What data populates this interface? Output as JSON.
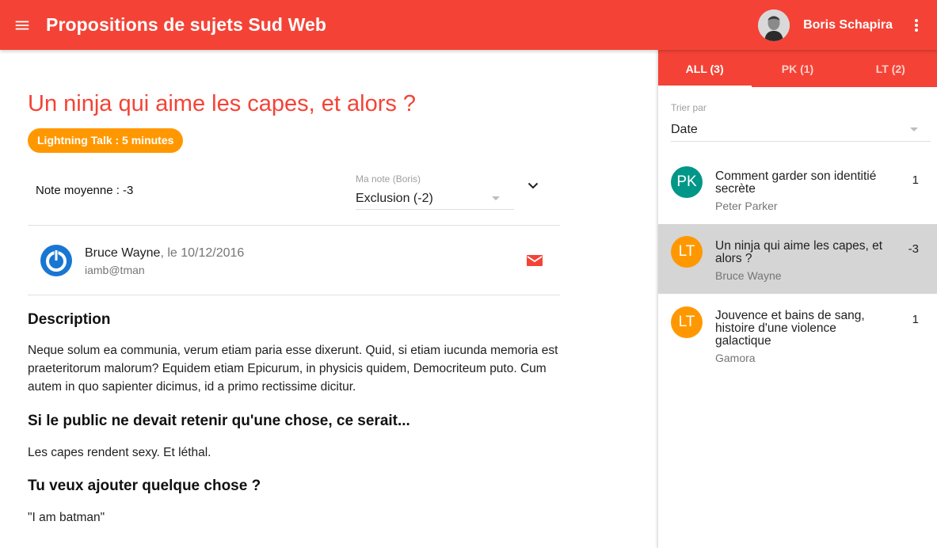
{
  "app": {
    "title": "Propositions de sujets Sud Web"
  },
  "user": {
    "name": "Boris Schapira"
  },
  "talk": {
    "title": "Un ninja qui aime les capes, et alors ?",
    "format_chip": "Lightning Talk : 5 minutes",
    "average_label": "Note moyenne : -3",
    "my_note_label": "Ma note (Boris)",
    "my_note_value": "Exclusion (-2)",
    "author_name": "Bruce Wayne",
    "author_date": ", le 10/12/2016",
    "author_email": "iamb@tman",
    "description_heading": "Description",
    "description_text": "Neque solum ea communia, verum etiam paria esse dixerunt. Quid, si etiam iucunda memoria est praeteritorum malorum? Equidem etiam Epicurum, in physicis quidem, Democriteum puto. Cum autem in quo sapienter dicimus, id a primo rectissime dicitur.",
    "retain_heading": "Si le public ne devait retenir qu'une chose, ce serait...",
    "retain_text": "Les capes rendent sexy. Et léthal.",
    "extra_heading": "Tu veux ajouter quelque chose ?",
    "extra_text": "\"I am batman\""
  },
  "sidebar": {
    "tabs": [
      {
        "label": "ALL (3)",
        "active": true
      },
      {
        "label": "PK (1)",
        "active": false
      },
      {
        "label": "LT (2)",
        "active": false
      }
    ],
    "sort_label": "Trier par",
    "sort_value": "Date",
    "items": [
      {
        "initials": "PK",
        "color": "#009688",
        "title_lines": [
          "Comment garder son identitié",
          "secrète"
        ],
        "author": "Peter Parker",
        "score": "1",
        "selected": false
      },
      {
        "initials": "LT",
        "color": "#ff9800",
        "title_lines": [
          "Un ninja qui aime les capes, et",
          "alors ?"
        ],
        "author": "Bruce Wayne",
        "score": "-3",
        "selected": true
      },
      {
        "initials": "LT",
        "color": "#ff9800",
        "title_lines": [
          "Jouvence et bains de sang,",
          "histoire d'une violence",
          "galactique"
        ],
        "author": "Gamora",
        "score": "1",
        "selected": false
      }
    ]
  },
  "colors": {
    "primary": "#f44336",
    "accent": "#ff9800",
    "teal": "#009688",
    "selected_row": "#d5d5d5"
  }
}
